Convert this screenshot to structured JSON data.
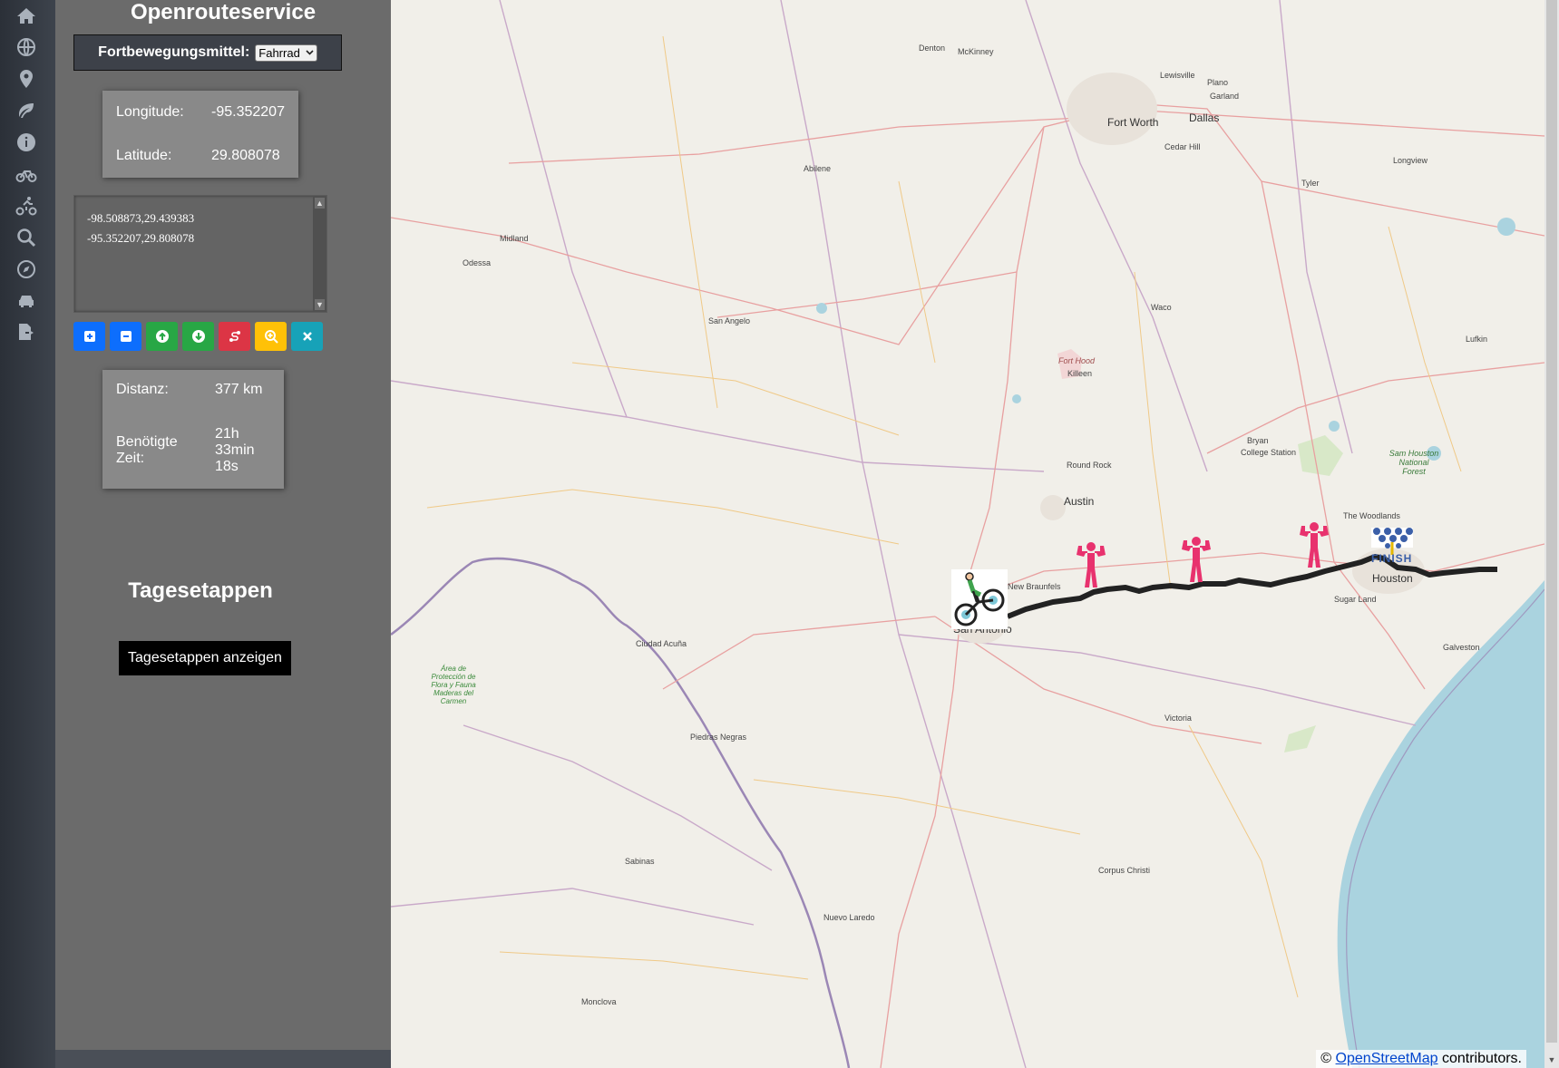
{
  "sidebar_icons": [
    "home-icon",
    "globe-icon",
    "map-pin-icon",
    "leaf-icon",
    "info-icon",
    "bicycle-icon",
    "biking-icon",
    "search-zoom-icon",
    "compass-icon",
    "car-icon",
    "export-file-icon"
  ],
  "app": {
    "title": "Openrouteservice"
  },
  "transport": {
    "label": "Fortbewegungsmittel:",
    "selected": "Fahrrad"
  },
  "coords": {
    "longitude_label": "Longitude:",
    "longitude_value": "-95.352207",
    "latitude_label": "Latitude:",
    "latitude_value": "29.808078"
  },
  "waypoints_text": "-98.508873,29.439383\n-95.352207,29.808078",
  "toolbar": [
    {
      "name": "add-waypoint-button",
      "icon": "plus-square-icon",
      "color": "#0d6efd"
    },
    {
      "name": "remove-waypoint-button",
      "icon": "minus-square-icon",
      "color": "#0d6efd"
    },
    {
      "name": "move-up-button",
      "icon": "arrow-up-circle-icon",
      "color": "#28a745"
    },
    {
      "name": "move-down-button",
      "icon": "arrow-down-circle-icon",
      "color": "#28a745"
    },
    {
      "name": "route-button",
      "icon": "route-icon",
      "color": "#dc3545"
    },
    {
      "name": "zoom-route-button",
      "icon": "zoom-in-icon",
      "color": "#ffc107"
    },
    {
      "name": "clear-button",
      "icon": "x-icon",
      "color": "#17a2b8"
    }
  ],
  "stats": {
    "distance_label": "Distanz:",
    "distance_value": "377 km",
    "time_label_1": "Benötigte",
    "time_label_2": "Zeit:",
    "time_h": "21h",
    "time_min": "33min",
    "time_s": "18s"
  },
  "stages": {
    "heading": "Tagesetappen",
    "button": "Tagesetappen anzeigen"
  },
  "map": {
    "attribution_prefix": "©",
    "attribution_link": "OpenStreetMap",
    "attribution_suffix": "contributors.",
    "cities": [
      "Denton",
      "McKinney",
      "Lewisville",
      "Plano",
      "Garland",
      "Fort Worth",
      "Dallas",
      "Cedar Hill",
      "Longview",
      "Abilene",
      "Tyler",
      "Midland",
      "Odessa",
      "San Angelo",
      "Waco",
      "Lufkin",
      "Fort Hood",
      "Killeen",
      "Bryan",
      "College Station",
      "Sam Houston National Forest",
      "Round Rock",
      "Austin",
      "The Woodlands",
      "New Braunfels",
      "San Antonio",
      "Houston",
      "Sugar Land",
      "Ciudad Acuña",
      "Galveston",
      "Victoria",
      "Piedras Negras",
      "Sabinas",
      "Corpus Christi",
      "Nuevo Laredo",
      "Monclova",
      "Área de Protección de Flora y Fauna Maderas del Carmen"
    ],
    "finish_label": "FINISH",
    "route_color": "#222222",
    "stage_marker_color": "#e8326e"
  }
}
